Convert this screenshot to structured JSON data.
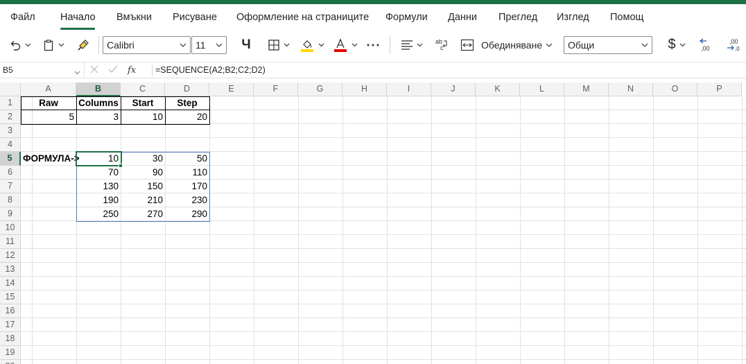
{
  "colors": {
    "accent": "#1e7145",
    "spill_border": "#4f7fbf",
    "fill_yellow": "#ffd700",
    "font_red": "#e00000"
  },
  "menu": {
    "tabs": [
      {
        "label": "Файл"
      },
      {
        "label": "Начало",
        "active": true
      },
      {
        "label": "Вмъкни"
      },
      {
        "label": "Рисуване"
      },
      {
        "label": "Оформление на страниците"
      },
      {
        "label": "Формули"
      },
      {
        "label": "Данни"
      },
      {
        "label": "Преглед"
      },
      {
        "label": "Изглед"
      },
      {
        "label": "Помощ"
      }
    ]
  },
  "ribbon": {
    "font_name": "Calibri",
    "font_size": "11",
    "bold_label": "Ч",
    "merge_label": "Обединяване",
    "number_format": "Общи",
    "currency_symbol": "$",
    "icons": [
      "undo-icon",
      "clipboard-icon",
      "format-painter-icon",
      "borders-icon",
      "fill-color-icon",
      "font-color-icon",
      "more-icon",
      "align-icon",
      "wrap-text-icon",
      "merge-icon",
      "increase-decimal-icon",
      "decrease-decimal-icon"
    ]
  },
  "formula_bar": {
    "name_box": "B5",
    "fx_label": "fx",
    "formula": "=SEQUENCE(A2;B2;C2;D2)"
  },
  "sheet": {
    "columns": [
      "A",
      "B",
      "C",
      "D",
      "E",
      "F",
      "G",
      "H",
      "I",
      "J",
      "K",
      "L",
      "M",
      "N",
      "O",
      "P"
    ],
    "selected_column": "B",
    "rows": [
      "1",
      "2",
      "3",
      "4",
      "5",
      "6",
      "7",
      "8",
      "9",
      "10",
      "11",
      "12",
      "13",
      "14",
      "15",
      "16",
      "17",
      "18",
      "19",
      "20"
    ],
    "selected_row": "5",
    "headers": {
      "a1": "Raw",
      "b1": "Columns",
      "c1": "Start",
      "d1": "Step"
    },
    "inputs": {
      "a2": "5",
      "b2": "3",
      "c2": "10",
      "d2": "20"
    },
    "label_a5": "ФОРМУЛА->",
    "spill": [
      [
        "10",
        "30",
        "50"
      ],
      [
        "70",
        "90",
        "110"
      ],
      [
        "130",
        "150",
        "170"
      ],
      [
        "190",
        "210",
        "230"
      ],
      [
        "250",
        "270",
        "290"
      ]
    ]
  }
}
